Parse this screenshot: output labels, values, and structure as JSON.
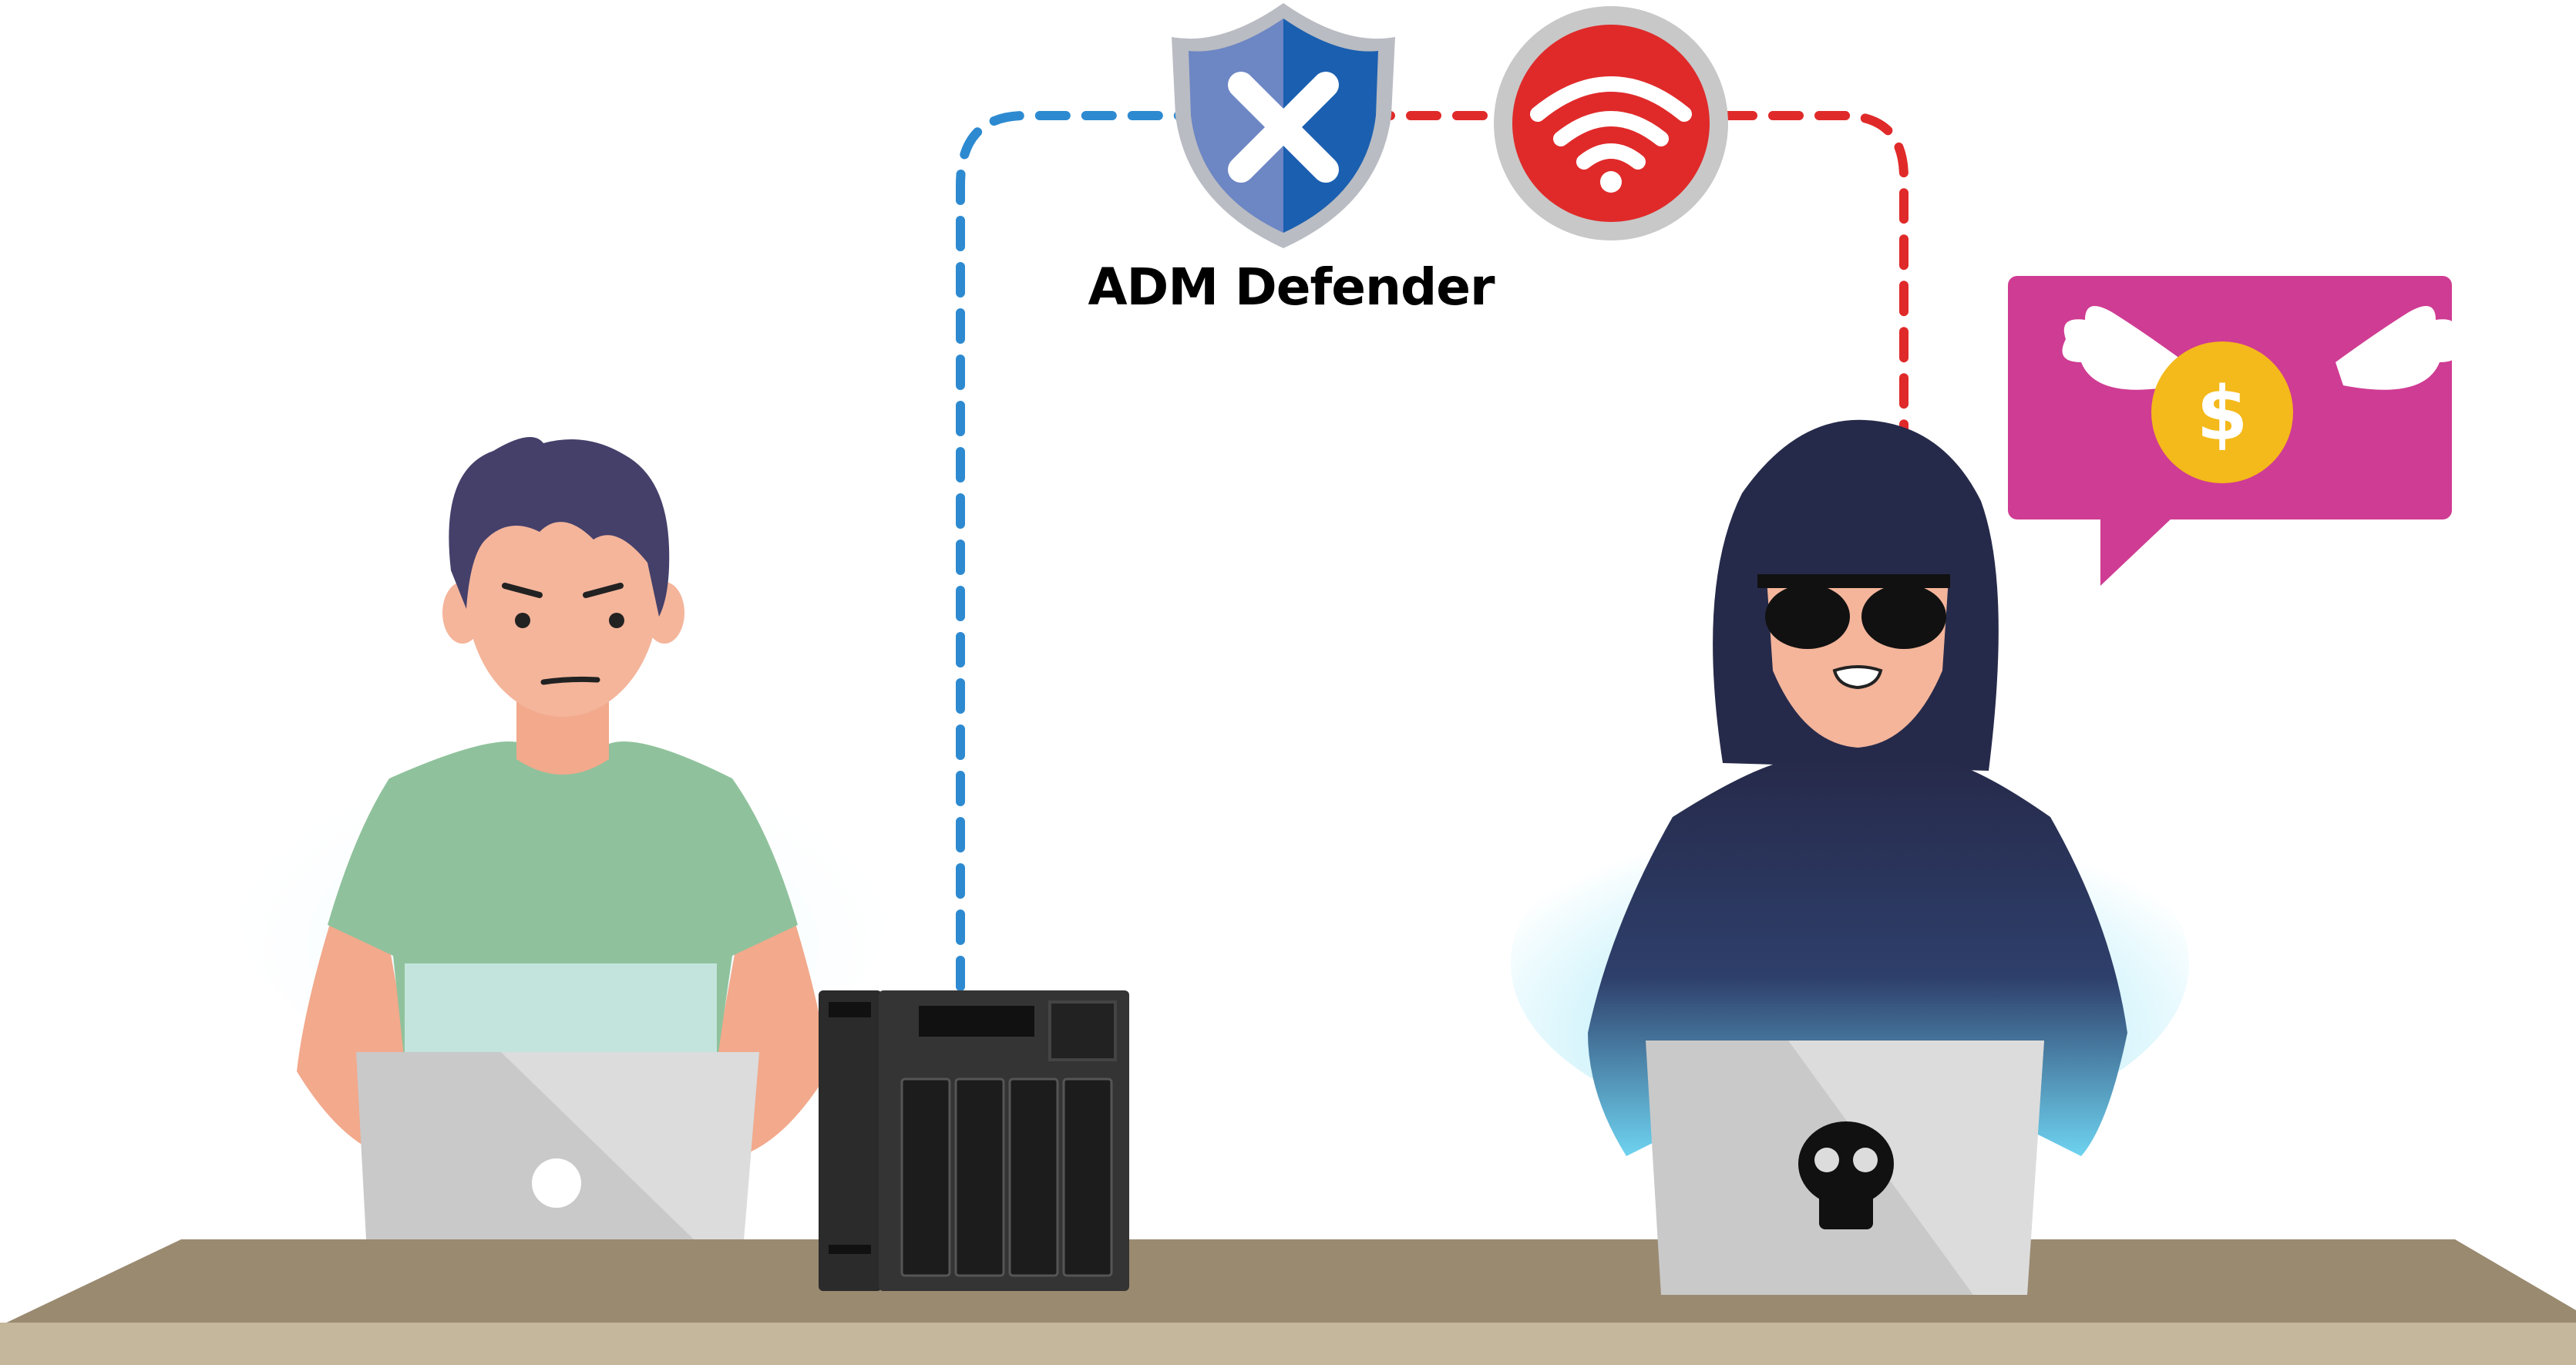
{
  "shield": {
    "label": "ADM Defender",
    "icon": "shield-x-icon",
    "color_left": "#6d86c4",
    "color_right": "#1b5fb0"
  },
  "wifi_badge": {
    "icon": "wifi-icon",
    "color": "#e02a2a"
  },
  "speech_bubble": {
    "icon": "flying-money-icon",
    "color": "#cf3c93",
    "coin_symbol": "$"
  },
  "user": {
    "name": "user-figure",
    "shirt_color": "#8fc29c",
    "hair_color": "#44406a"
  },
  "hacker": {
    "name": "hacker-figure",
    "hoodie_color": "#262a4a"
  },
  "nas": {
    "icon": "nas-device-icon",
    "color": "#2e2e2e"
  },
  "user_laptop": {
    "icon": "laptop-icon",
    "logo": "circle-logo-icon"
  },
  "hacker_laptop": {
    "icon": "laptop-icon",
    "logo": "skull-icon"
  },
  "connections": {
    "safe_color": "#2d8ad1",
    "threat_color": "#e02a2a"
  },
  "desk": {
    "top_color": "#9a8a70",
    "front_color": "#c5b79c"
  }
}
